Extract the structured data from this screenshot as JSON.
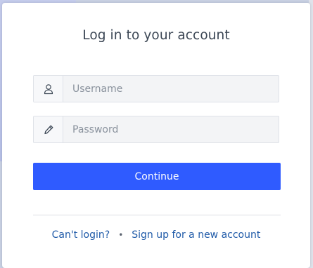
{
  "login": {
    "title": "Log in to your account",
    "username": {
      "placeholder": "Username",
      "value": "",
      "icon": "user-icon"
    },
    "password": {
      "placeholder": "Password",
      "value": "",
      "icon": "pencil-icon"
    },
    "continue_label": "Continue",
    "links": {
      "cant_login": "Can't login?",
      "separator": "•",
      "signup": "Sign up for a new account"
    }
  },
  "colors": {
    "primary_button": "#2f5bff",
    "link": "#1f5aa8",
    "title_text": "#3b4654",
    "field_bg": "#f3f4f6"
  }
}
